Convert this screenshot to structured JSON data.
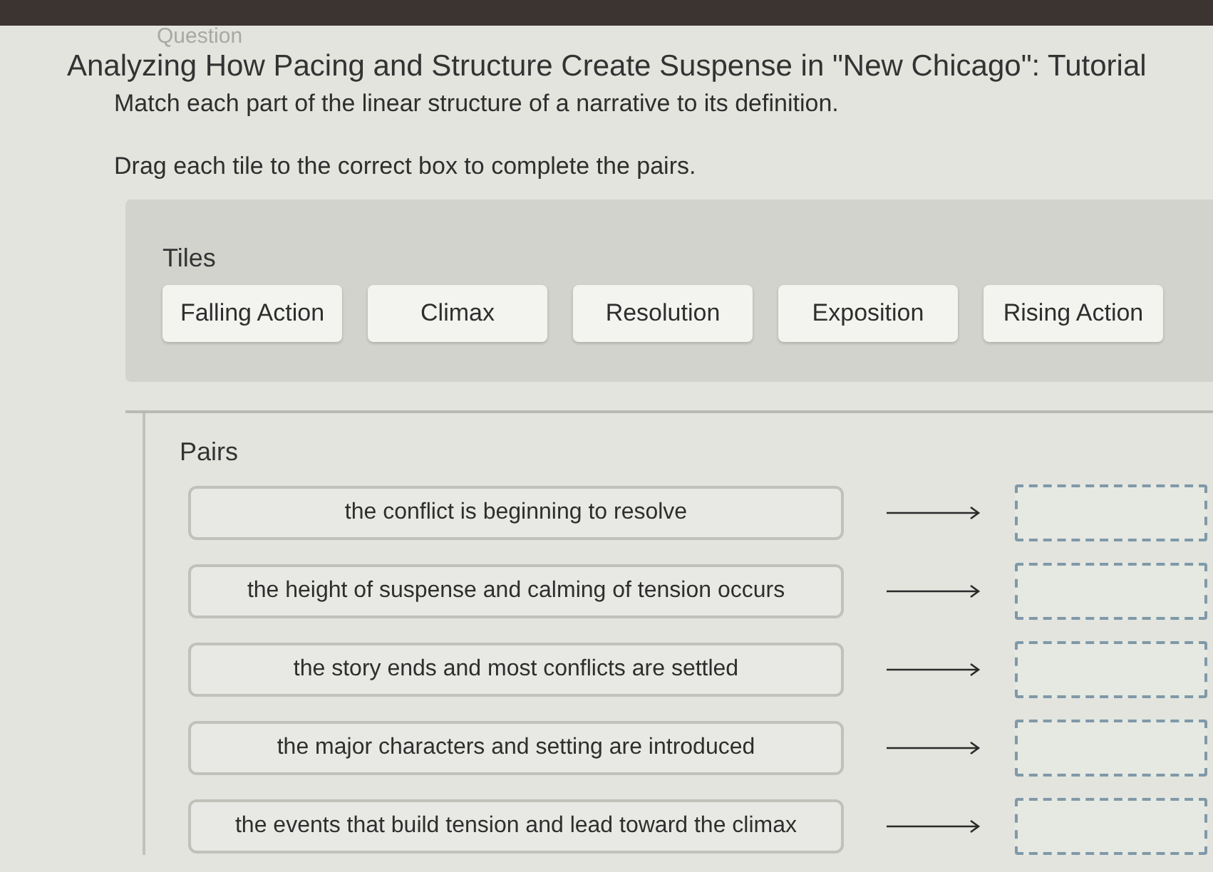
{
  "question_label": "Question",
  "title": "Analyzing How Pacing and Structure Create Suspense in \"New Chicago\": Tutorial",
  "instructions": [
    "Match each part of the linear structure of a narrative to its definition.",
    "Drag each tile to the correct box to complete the pairs."
  ],
  "tiles": {
    "heading": "Tiles",
    "items": [
      "Falling Action",
      "Climax",
      "Resolution",
      "Exposition",
      "Rising Action"
    ]
  },
  "pairs": {
    "heading": "Pairs",
    "rows": [
      {
        "definition": "the conflict is beginning to resolve"
      },
      {
        "definition": "the height of suspense and calming of tension occurs"
      },
      {
        "definition": "the story ends and most conflicts are settled"
      },
      {
        "definition": "the major characters and setting are introduced"
      },
      {
        "definition": "the events that build tension and lead toward the climax"
      }
    ]
  }
}
